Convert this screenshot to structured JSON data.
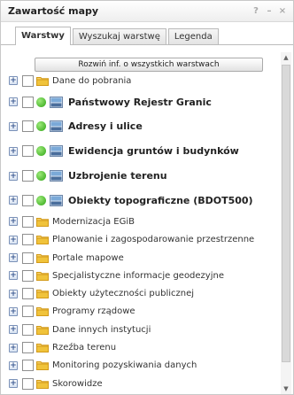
{
  "window": {
    "title": "Zawartość mapy",
    "help_label": "?",
    "minimize_label": "–",
    "close_label": "×"
  },
  "tabs": [
    {
      "label": "Warstwy"
    },
    {
      "label": "Wyszukaj warstwę"
    },
    {
      "label": "Legenda"
    }
  ],
  "expand_all_label": "Rozwiń inf. o wszystkich warstwach",
  "layers": [
    {
      "label": "Dane do pobrania"
    },
    {
      "label": "Państwowy Rejestr Granic"
    },
    {
      "label": "Adresy i ulice"
    },
    {
      "label": "Ewidencja gruntów i budynków"
    },
    {
      "label": "Uzbrojenie terenu"
    },
    {
      "label": "Obiekty topograficzne (BDOT500)"
    },
    {
      "label": "Modernizacja EGiB"
    },
    {
      "label": "Planowanie i zagospodarowanie przestrzenne"
    },
    {
      "label": "Portale mapowe"
    },
    {
      "label": "Specjalistyczne informacje geodezyjne"
    },
    {
      "label": "Obiekty użyteczności publicznej"
    },
    {
      "label": "Programy rządowe"
    },
    {
      "label": "Dane innych instytucji"
    },
    {
      "label": "Rzeźba terenu"
    },
    {
      "label": "Monitoring pozyskiwania danych"
    },
    {
      "label": "Skorowidze"
    }
  ],
  "colors": {
    "active_dot": "#2fa515",
    "folder": "#f0c33b",
    "wms_badge": "#4a6e9c"
  },
  "icons": {
    "expand": "plus-box-icon",
    "folder": "folder-icon",
    "active": "green-dot-icon",
    "service": "wms-icon"
  }
}
